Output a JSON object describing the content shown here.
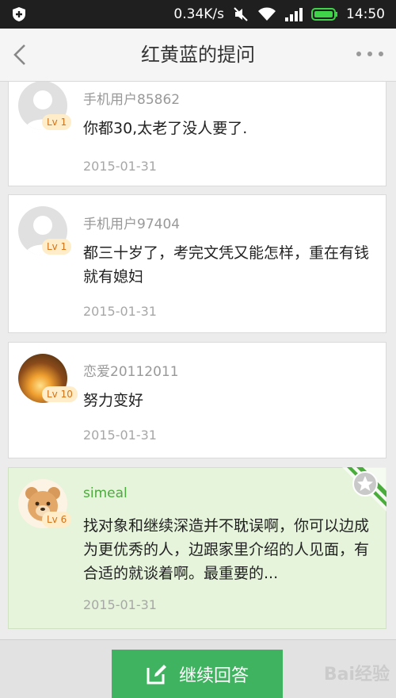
{
  "status_bar": {
    "speed": "0.34K/s",
    "time": "14:50"
  },
  "nav": {
    "title": "红黄蓝的提问"
  },
  "answers": [
    {
      "user": "手机用户85862",
      "level": "Lv 1",
      "content": "你都30,太老了没人要了.",
      "date": "2015-01-31"
    },
    {
      "user": "手机用户97404",
      "level": "Lv 1",
      "content": "都三十岁了，考完文凭又能怎样，重在有钱就有媳妇",
      "date": "2015-01-31"
    },
    {
      "user": "恋爱20112011",
      "level": "Lv 10",
      "content": "努力变好",
      "date": "2015-01-31"
    },
    {
      "user": "simeal",
      "level": "Lv 6",
      "content": "找对象和继续深造并不耽误啊，你可以边成为更优秀的人，边跟家里介绍的人见面，有合适的就谈着啊。最重要的...",
      "date": "2015-01-31"
    }
  ],
  "bottom": {
    "continue_label": "继续回答"
  },
  "watermark": "Bai经验"
}
